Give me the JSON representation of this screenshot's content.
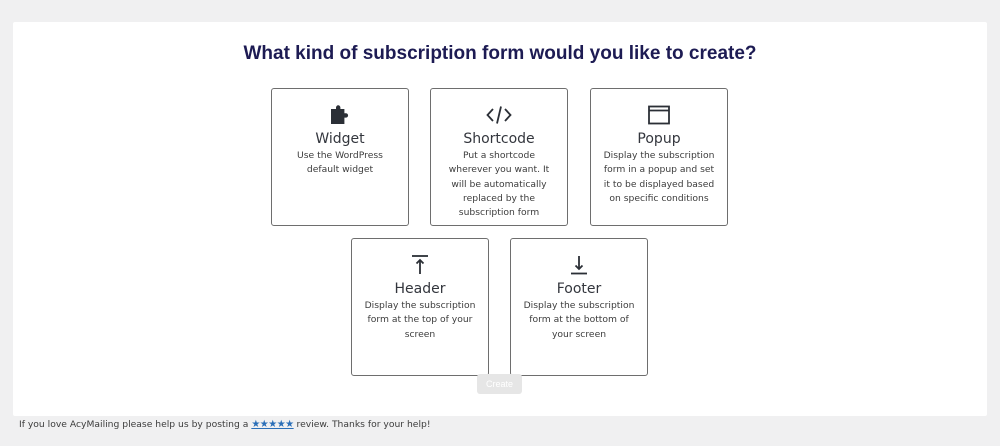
{
  "page_title": "What kind of subscription form would you like to create?",
  "cards": [
    {
      "name": "Widget",
      "icon": "puzzle-icon",
      "description": "Use the WordPress default widget"
    },
    {
      "name": "Shortcode",
      "icon": "code-icon",
      "description": "Put a shortcode wherever you want. It will be automatically replaced by the subscription form"
    },
    {
      "name": "Popup",
      "icon": "window-icon",
      "description": "Display the subscription form in a popup and set it to be displayed based on specific conditions"
    },
    {
      "name": "Header",
      "icon": "arrow-up-to-line-icon",
      "description": "Display the subscription form at the top of your screen"
    },
    {
      "name": "Footer",
      "icon": "arrow-down-to-line-icon",
      "description": "Display the subscription form at the bottom of your screen"
    }
  ],
  "create_button": "Create",
  "footer": {
    "before": "If you love AcyMailing please help us by posting a ",
    "stars": "★★★★★",
    "after": " review. Thanks for your help!"
  },
  "colors": {
    "title": "#1d1b53",
    "stars": "#2b6fb8",
    "background": "#f0f0f1"
  }
}
